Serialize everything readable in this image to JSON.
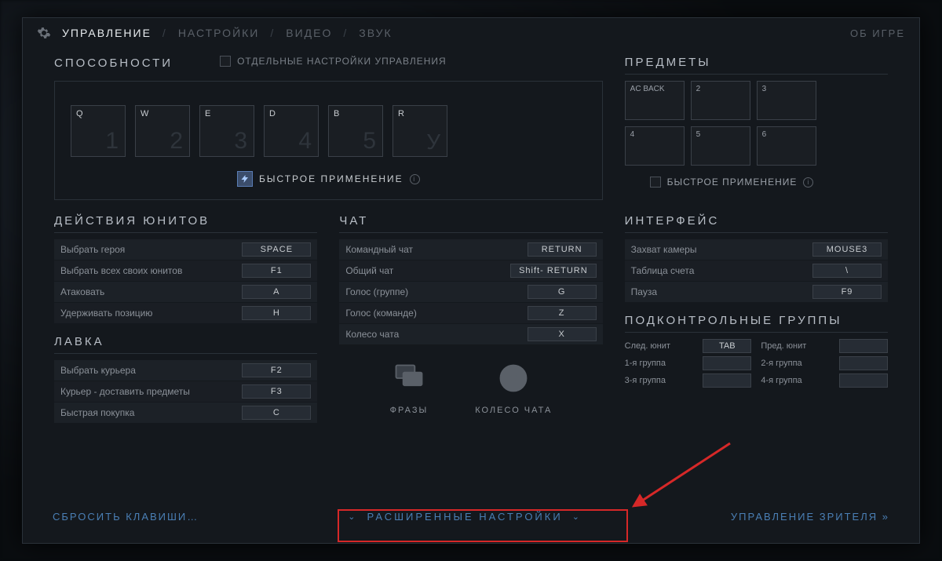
{
  "topbar": {
    "tabs": [
      "УПРАВЛЕНИЕ",
      "НАСТРОЙКИ",
      "ВИДЕО",
      "ЗВУК"
    ],
    "active": 0,
    "about": "ОБ ИГРЕ"
  },
  "abilities": {
    "title": "СПОСОБНОСТИ",
    "separate_controls": "ОТДЕЛЬНЫЕ НАСТРОЙКИ УПРАВЛЕНИЯ",
    "slots": [
      {
        "key": "Q",
        "num": "1"
      },
      {
        "key": "W",
        "num": "2"
      },
      {
        "key": "E",
        "num": "3"
      },
      {
        "key": "D",
        "num": "4"
      },
      {
        "key": "B",
        "num": "5"
      },
      {
        "key": "R",
        "num": "У"
      }
    ],
    "quickcast": "БЫСТРОЕ ПРИМЕНЕНИЕ"
  },
  "items": {
    "title": "ПРЕДМЕТЫ",
    "slots": [
      "AC BACK",
      "2",
      "3",
      "4",
      "5",
      "6"
    ],
    "quickcast": "БЫСТРОЕ ПРИМЕНЕНИЕ"
  },
  "unit_actions": {
    "title": "ДЕЙСТВИЯ ЮНИТОВ",
    "rows": [
      {
        "label": "Выбрать героя",
        "key": "SPACE"
      },
      {
        "label": "Выбрать всех своих юнитов",
        "key": "F1"
      },
      {
        "label": "Атаковать",
        "key": "A"
      },
      {
        "label": "Удерживать позицию",
        "key": "H"
      }
    ]
  },
  "shop": {
    "title": "ЛАВКА",
    "rows": [
      {
        "label": "Выбрать курьера",
        "key": "F2"
      },
      {
        "label": "Курьер - доставить предметы",
        "key": "F3"
      },
      {
        "label": "Быстрая покупка",
        "key": "C"
      }
    ]
  },
  "chat": {
    "title": "ЧАТ",
    "rows": [
      {
        "label": "Командный чат",
        "key": "RETURN"
      },
      {
        "label": "Общий чат",
        "key": "Shift- RETURN"
      },
      {
        "label": "Голос (группе)",
        "key": "G"
      },
      {
        "label": "Голос (команде)",
        "key": "Z"
      },
      {
        "label": "Колесо чата",
        "key": "X"
      }
    ],
    "phrases": "ФРАЗЫ",
    "wheel": "КОЛЕСО ЧАТА"
  },
  "interface": {
    "title": "ИНТЕРФЕЙС",
    "rows": [
      {
        "label": "Захват камеры",
        "key": "MOUSE3"
      },
      {
        "label": "Таблица счета",
        "key": "\\"
      },
      {
        "label": "Пауза",
        "key": "F9"
      }
    ]
  },
  "control_groups": {
    "title": "ПОДКОНТРОЛЬНЫЕ ГРУППЫ",
    "cells": [
      {
        "label": "След. юнит",
        "key": "TAB"
      },
      {
        "label": "Пред. юнит",
        "key": ""
      },
      {
        "label": "1-я группа",
        "key": ""
      },
      {
        "label": "2-я группа",
        "key": ""
      },
      {
        "label": "3-я группа",
        "key": ""
      },
      {
        "label": "4-я группа",
        "key": ""
      }
    ]
  },
  "footer": {
    "reset": "СБРОСИТЬ КЛАВИШИ…",
    "advanced": "РАСШИРЕННЫЕ НАСТРОЙКИ",
    "spectator": "УПРАВЛЕНИЕ ЗРИТЕЛЯ"
  }
}
